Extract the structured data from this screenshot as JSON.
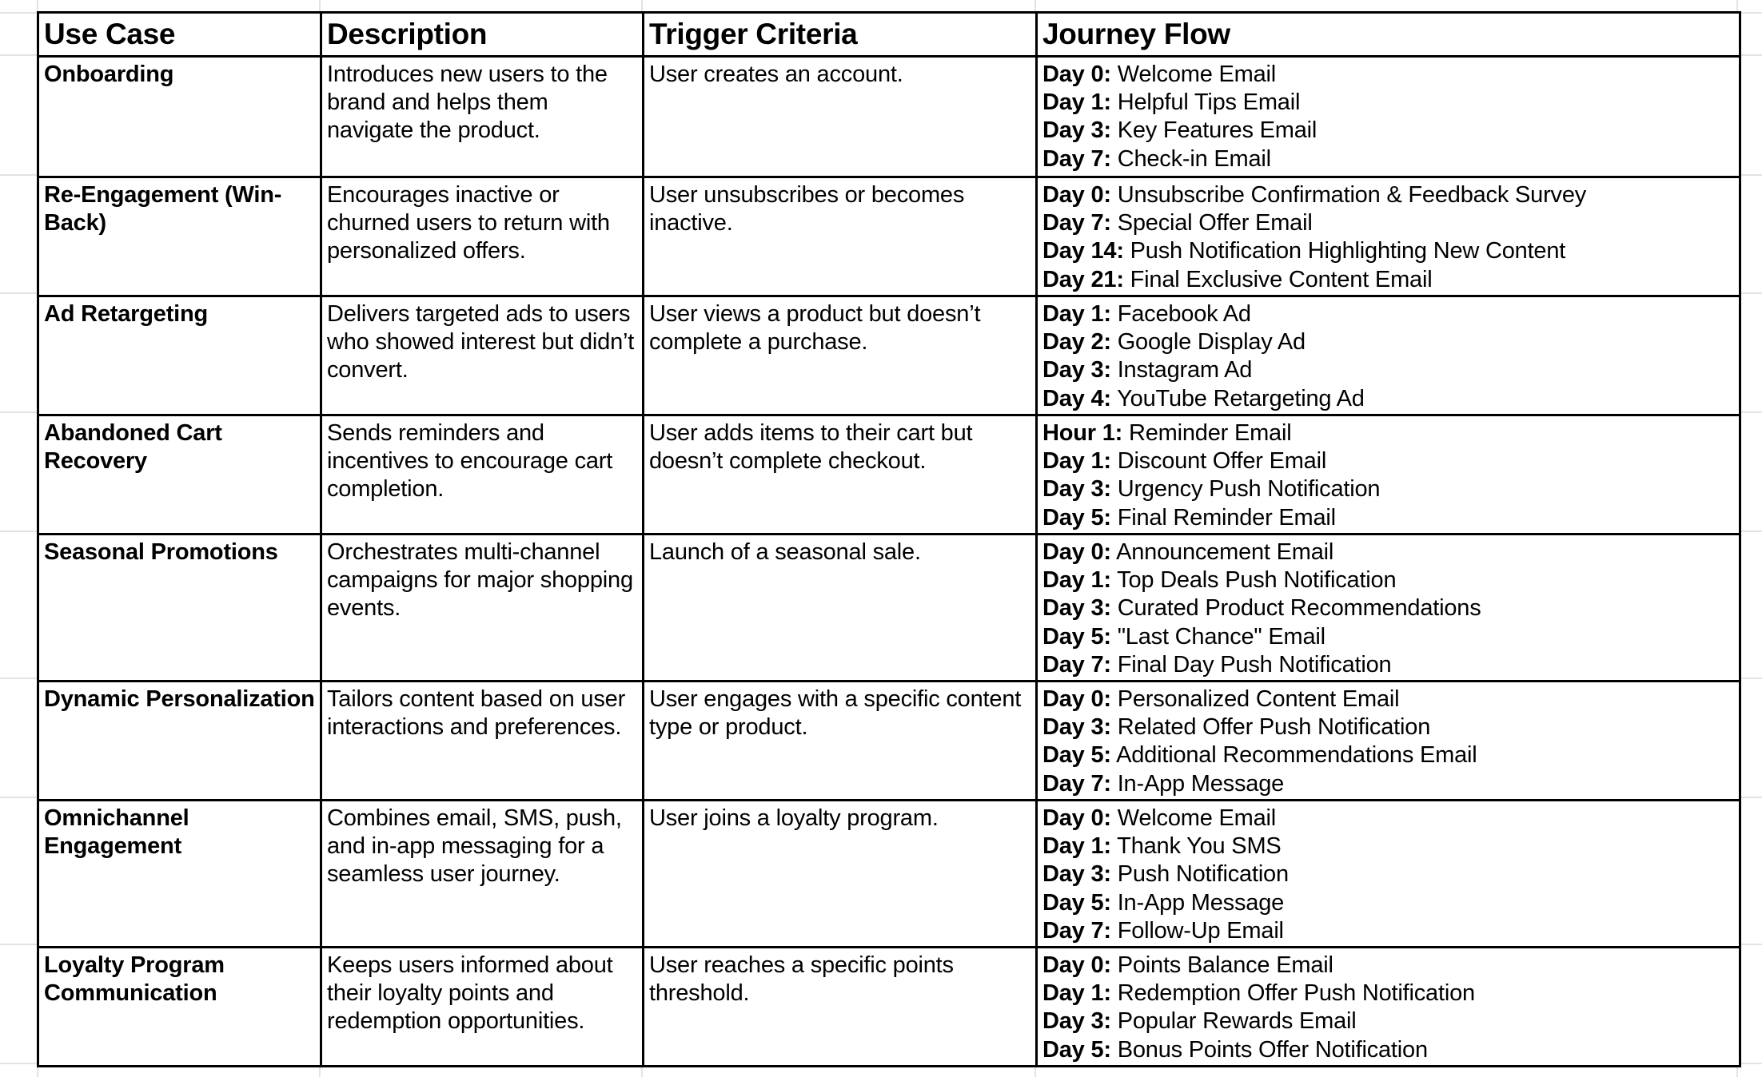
{
  "table": {
    "headers": [
      "Use Case",
      "Description",
      "Trigger Criteria",
      "Journey Flow"
    ],
    "rows": [
      {
        "use_case": "Onboarding",
        "description": "Introduces new users to the brand and helps them navigate the product.",
        "trigger": "User creates an account.",
        "journey": [
          {
            "label": "Day 0:",
            "text": " Welcome Email"
          },
          {
            "label": "Day 1:",
            "text": " Helpful Tips Email"
          },
          {
            "label": "Day 3:",
            "text": " Key Features Email"
          },
          {
            "label": "Day 7:",
            "text": " Check-in Email"
          }
        ]
      },
      {
        "use_case": "Re-Engagement (Win-Back)",
        "description": "Encourages inactive or churned users to return with personalized offers.",
        "trigger": "User unsubscribes or becomes inactive.",
        "journey": [
          {
            "label": "Day 0:",
            "text": " Unsubscribe Confirmation & Feedback Survey"
          },
          {
            "label": "Day 7:",
            "text": " Special Offer Email"
          },
          {
            "label": "Day 14:",
            "text": " Push Notification Highlighting New Content"
          },
          {
            "label": "Day 21:",
            "text": " Final Exclusive Content Email"
          }
        ]
      },
      {
        "use_case": "Ad Retargeting",
        "description": "Delivers targeted ads to users who showed interest but didn’t convert.",
        "trigger": "User views a product but doesn’t complete a purchase.",
        "journey": [
          {
            "label": "Day 1:",
            "text": " Facebook Ad"
          },
          {
            "label": "Day 2:",
            "text": " Google Display Ad"
          },
          {
            "label": "Day 3:",
            "text": " Instagram Ad"
          },
          {
            "label": "Day 4:",
            "text": " YouTube Retargeting Ad"
          }
        ]
      },
      {
        "use_case": "Abandoned Cart Recovery",
        "description": "Sends reminders and incentives to encourage cart completion.",
        "trigger": "User adds items to their cart but doesn’t complete checkout.",
        "journey": [
          {
            "label": "Hour 1:",
            "text": " Reminder Email"
          },
          {
            "label": "Day 1:",
            "text": " Discount Offer Email"
          },
          {
            "label": "Day 3:",
            "text": " Urgency Push Notification"
          },
          {
            "label": "Day 5:",
            "text": " Final Reminder Email"
          }
        ]
      },
      {
        "use_case": "Seasonal Promotions",
        "description": "Orchestrates multi-channel campaigns for major shopping events.",
        "trigger": "Launch of a seasonal sale.",
        "journey": [
          {
            "label": "Day 0:",
            "text": " Announcement Email"
          },
          {
            "label": "Day 1:",
            "text": " Top Deals Push Notification"
          },
          {
            "label": "Day 3:",
            "text": " Curated Product Recommendations"
          },
          {
            "label": "Day 5:",
            "text": " \"Last Chance\" Email"
          },
          {
            "label": "Day 7:",
            "text": " Final Day Push Notification"
          }
        ]
      },
      {
        "use_case": "Dynamic Personalization",
        "description": "Tailors content based on user interactions and preferences.",
        "trigger": "User engages with a specific content type or product.",
        "journey": [
          {
            "label": "Day 0:",
            "text": " Personalized Content Email"
          },
          {
            "label": "Day 3:",
            "text": " Related Offer Push Notification"
          },
          {
            "label": "Day 5:",
            "text": " Additional Recommendations Email"
          },
          {
            "label": "Day 7:",
            "text": " In-App Message"
          }
        ]
      },
      {
        "use_case": "Omnichannel Engagement",
        "description": "Combines email, SMS, push, and in-app messaging for a seamless user journey.",
        "trigger": "User joins a loyalty program.",
        "journey": [
          {
            "label": "Day 0:",
            "text": " Welcome Email"
          },
          {
            "label": "Day 1:",
            "text": " Thank You SMS"
          },
          {
            "label": "Day 3:",
            "text": " Push Notification"
          },
          {
            "label": "Day 5:",
            "text": " In-App Message"
          },
          {
            "label": "Day 7:",
            "text": " Follow-Up Email"
          }
        ]
      },
      {
        "use_case": "Loyalty Program Communication",
        "description": "Keeps users informed about their loyalty points and redemption opportunities.",
        "trigger": "User reaches a specific points threshold.",
        "journey": [
          {
            "label": "Day 0:",
            "text": " Points Balance Email"
          },
          {
            "label": "Day 1:",
            "text": " Redemption Offer Push Notification"
          },
          {
            "label": "Day 3:",
            "text": " Popular Rewards Email"
          },
          {
            "label": "Day 5:",
            "text": " Bonus Points Offer Notification"
          }
        ]
      }
    ]
  }
}
